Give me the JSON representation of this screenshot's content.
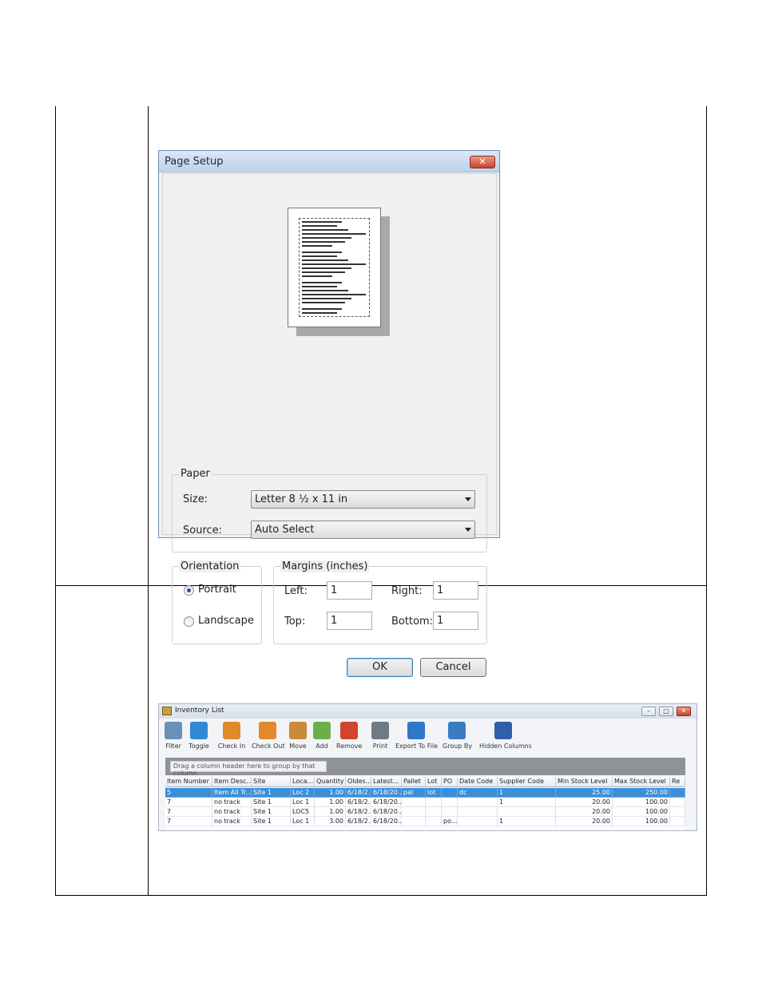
{
  "page_setup": {
    "title": "Page Setup",
    "close_glyph": "✕",
    "paper_group": "Paper",
    "size_label": "Size:",
    "size_value": "Letter 8 ½ x 11 in",
    "source_label": "Source:",
    "source_value": "Auto Select",
    "orientation_group": "Orientation",
    "portrait_label": "Portrait",
    "landscape_label": "Landscape",
    "orientation_selected": "Portrait",
    "margins_group": "Margins (inches)",
    "left_label": "Left:",
    "left_value": "1",
    "right_label": "Right:",
    "right_value": "1",
    "top_label": "Top:",
    "top_value": "1",
    "bottom_label": "Bottom:",
    "bottom_value": "1",
    "ok_label": "OK",
    "cancel_label": "Cancel"
  },
  "inventory": {
    "title": "Inventory List",
    "window_buttons": [
      "–",
      "□",
      "✕"
    ],
    "toolbar": [
      {
        "label": "Filter",
        "icon": "magnifier-icon",
        "color": "#6a8fb8"
      },
      {
        "label": "Toggle",
        "icon": "funnel-icon",
        "color": "#2f8ad6"
      },
      {
        "label": "Check In",
        "icon": "user-check-in-icon",
        "color": "#e08a2a"
      },
      {
        "label": "Check Out",
        "icon": "user-check-out-icon",
        "color": "#e08a2a"
      },
      {
        "label": "Move",
        "icon": "move-icon",
        "color": "#c98a3a"
      },
      {
        "label": "Add",
        "icon": "add-icon",
        "color": "#6ab04a"
      },
      {
        "label": "Remove",
        "icon": "remove-icon",
        "color": "#d0452f"
      },
      {
        "label": "Print",
        "icon": "printer-icon",
        "color": "#6f7a86"
      },
      {
        "label": "Export To File",
        "icon": "export-icon",
        "color": "#2e78c9"
      },
      {
        "label": "Group By",
        "icon": "group-by-icon",
        "color": "#3a7cc4"
      },
      {
        "label": "Hidden Columns",
        "icon": "hidden-columns-icon",
        "color": "#2f5fa8"
      }
    ],
    "group_hint": "Drag a column header here to group by that column",
    "columns": [
      "Item Number",
      "Item Desc...",
      "Site",
      "Loca...",
      "Quantity",
      "Oldes...",
      "Latest...",
      "Pallet",
      "Lot",
      "PO",
      "Date Code",
      "Supplier Code",
      "Min Stock Level",
      "Max Stock Level",
      "Re"
    ],
    "rows": [
      [
        "5",
        "Item All Tr...",
        "Site 1",
        "Loc 2",
        "1.00",
        "6/18/2...",
        "6/18/20...",
        "pal",
        "lot",
        "",
        "dc",
        "1",
        "25.00",
        "250.00",
        ""
      ],
      [
        "7",
        "no track",
        "Site 1",
        "Loc 1",
        "1.00",
        "6/18/2...",
        "6/18/20...",
        "",
        "",
        "",
        "",
        "1",
        "20.00",
        "100.00",
        ""
      ],
      [
        "7",
        "no track",
        "Site 1",
        "LOC5",
        "1.00",
        "6/18/2...",
        "6/18/20...",
        "",
        "",
        "",
        "",
        "",
        "20.00",
        "100.00",
        ""
      ],
      [
        "7",
        "no track",
        "Site 1",
        "Loc 1",
        "3.00",
        "6/18/2...",
        "6/18/20...",
        "",
        "",
        "po...",
        "",
        "1",
        "20.00",
        "100.00",
        ""
      ]
    ]
  }
}
